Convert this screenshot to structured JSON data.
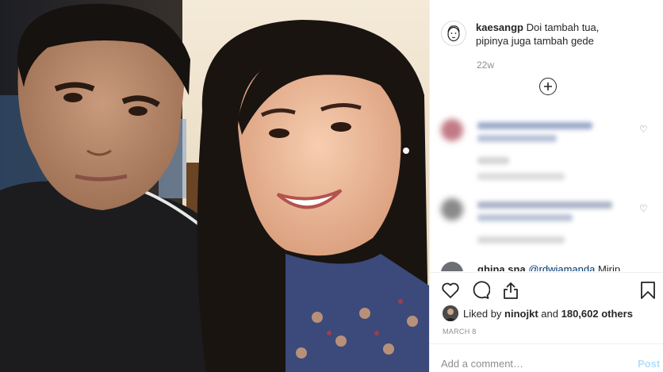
{
  "post": {
    "username": "kaesangp",
    "caption": "Doi tambah tua, pipinya juga tambah gede",
    "time": "22w",
    "load_more_icon": "plus-circle-icon"
  },
  "comments": {
    "partial_user": "ghina.sna",
    "partial_mention": "@rdwiamanda",
    "partial_text": "Mirip"
  },
  "actions": {
    "icons": [
      "heart-icon",
      "comment-icon",
      "share-icon",
      "bookmark-icon"
    ]
  },
  "likes": {
    "prefix": "Liked by",
    "user": "ninojkt",
    "and": "and",
    "count": "180,602 others"
  },
  "date": "MARCH 8",
  "comment_box": {
    "placeholder": "Add a comment…",
    "post_label": "Post"
  },
  "colors": {
    "accent": "#0095f6",
    "post_disabled": "#b2dffc",
    "muted": "#8e8e8e"
  }
}
